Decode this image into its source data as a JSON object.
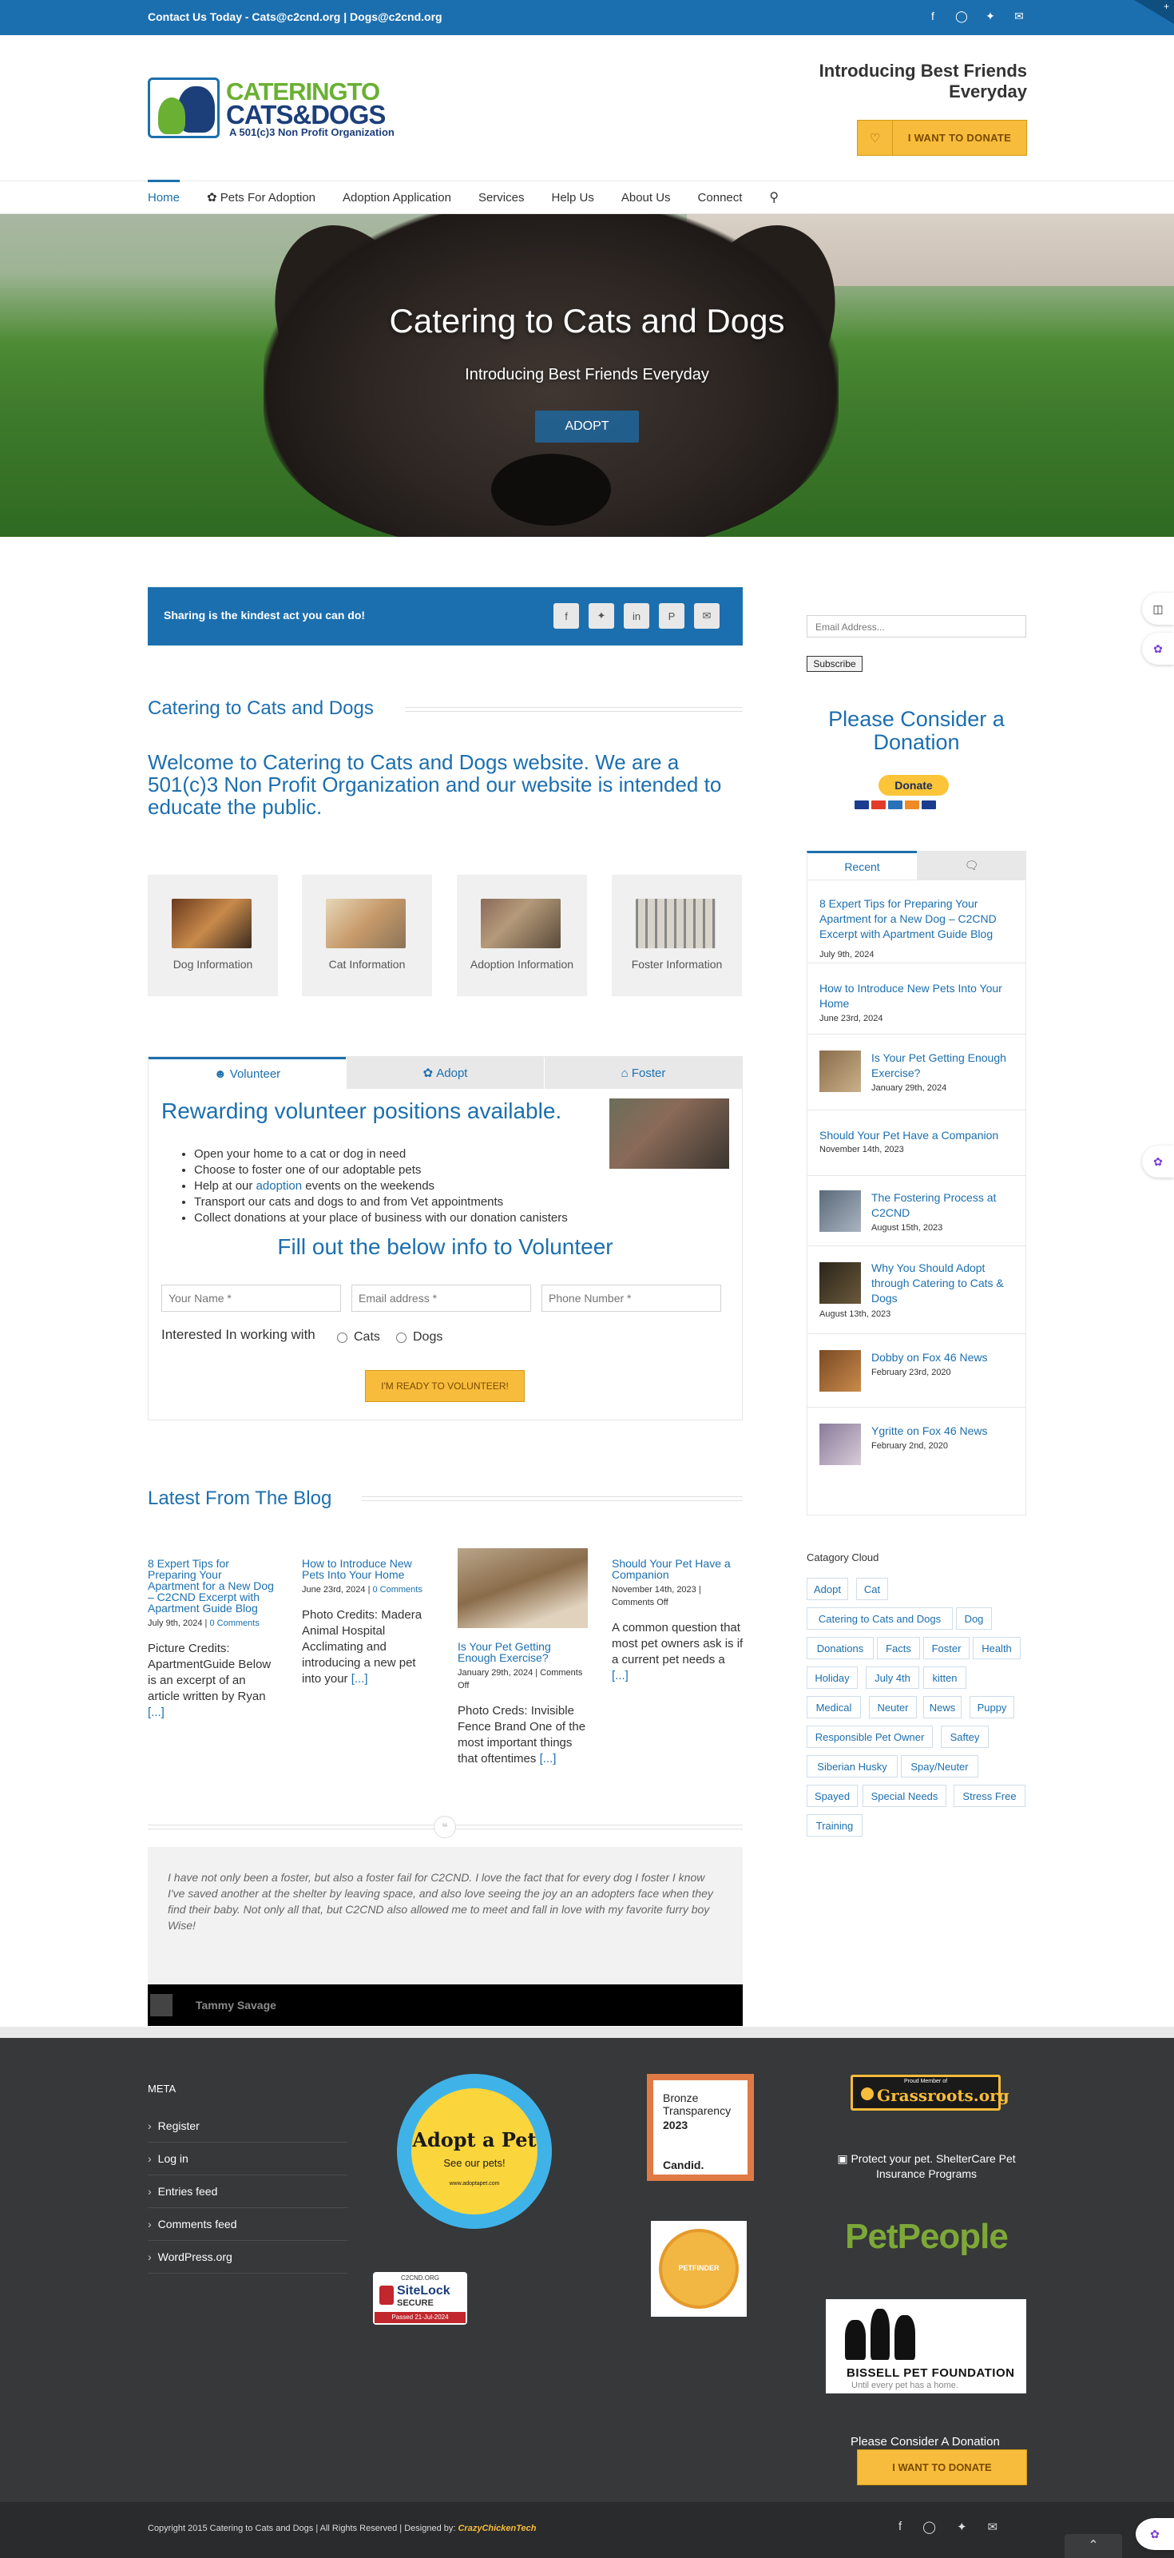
{
  "topbar": {
    "contact_prefix": "Contact Us Today - ",
    "email_cats": "Cats@c2cnd.org",
    "separator": "|",
    "email_dogs": "Dogs@c2cnd.org",
    "social": [
      "facebook-icon",
      "instagram-icon",
      "twitter-icon",
      "envelope-icon"
    ]
  },
  "header": {
    "logo_line1": "CATERINGTO",
    "logo_line2": "CATS&DOGS",
    "logo_line3": "A 501(c)3 Non Profit Organization",
    "tagline": "Introducing Best Friends Everyday",
    "donate_label": "I WANT TO DONATE"
  },
  "nav": {
    "items": [
      "Home",
      "Pets For Adoption",
      "Adoption Application",
      "Services",
      "Help Us",
      "About Us",
      "Connect"
    ]
  },
  "hero": {
    "title": "Catering to Cats and Dogs",
    "subtitle": "Introducing Best Friends Everyday",
    "button": "ADOPT"
  },
  "share": {
    "text": "Sharing is the kindest act you can do!",
    "icons": [
      "facebook-icon",
      "twitter-icon",
      "linkedin-icon",
      "pinterest-icon",
      "envelope-icon"
    ]
  },
  "main": {
    "section_title": "Catering to Cats and Dogs",
    "welcome": "Welcome to Catering to Cats and Dogs website. We are a 501(c)3 Non Profit Organization and our website is intended to educate the public.",
    "cards": [
      {
        "label": "Dog Information"
      },
      {
        "label": "Cat Information"
      },
      {
        "label": "Adoption Information"
      },
      {
        "label": "Foster Information"
      }
    ]
  },
  "tabs": {
    "items": [
      "Volunteer",
      "Adopt",
      "Foster"
    ],
    "heading": "Rewarding volunteer positions available.",
    "list": [
      "Open your home to a cat or dog in need",
      "Choose to foster one of our adoptable pets",
      "Transport our cats and dogs to and from Vet appointments",
      "Collect donations at your place of business with our donation canisters"
    ],
    "list_help_prefix": "Help at our ",
    "list_help_link": "adoption",
    "list_help_suffix": " events on the weekends",
    "form_title": "Fill out the below info to Volunteer",
    "name_placeholder": "Your Name *",
    "email_placeholder": "Email address *",
    "phone_placeholder": "Phone Number *",
    "interest_label": "Interested In working with",
    "option_cats": "Cats",
    "option_dogs": "Dogs",
    "submit": "I'M READY TO VOLUNTEER!"
  },
  "blog": {
    "title": "Latest From The Blog",
    "posts": [
      {
        "title": "8 Expert Tips for Preparing Your Apartment for a New Dog – C2CND Excerpt with Apartment Guide Blog",
        "date": "July 9th, 2024",
        "comments": "0 Comments",
        "body": "Picture Credits: ApartmentGuide Below is an excerpt of an article written by Ryan",
        "more": "[...]"
      },
      {
        "title": "How to Introduce New Pets Into Your Home",
        "date": "June 23rd, 2024",
        "comments": "0 Comments",
        "body": "Photo Credits: Madera Animal Hospital Acclimating and introducing a new pet into your",
        "more": "[...]"
      },
      {
        "title": "Is Your Pet Getting Enough Exercise?",
        "date": "January 29th, 2024",
        "comments": "Comments Off",
        "body": "Photo Creds: Invisible Fence Brand One of the most important things that oftentimes",
        "more": "[...]"
      },
      {
        "title": "Should Your Pet Have a Companion",
        "date": "November 14th, 2023",
        "comments": "Comments Off",
        "body": "A common question that most pet owners ask is if a current pet needs a",
        "more": "[...]"
      }
    ]
  },
  "testimonial": {
    "text": "I have not only been a foster, but also a foster fail for C2CND. I love the fact that for every dog I foster I know I've saved another at the shelter by leaving space, and also love seeing the joy an an adopters face when they find their baby. Not only all that, but C2CND also allowed me to meet and fall in love with my favorite furry boy Wise!",
    "name": "Tammy Savage"
  },
  "sidebar": {
    "email_placeholder": "Email Address...",
    "subscribe": "Subscribe",
    "consider": "Please Consider a Donation",
    "donate": "Donate",
    "tab_recent": "Recent",
    "recent": [
      {
        "title": "8 Expert Tips for Preparing Your Apartment for a New Dog – C2CND Excerpt with Apartment Guide Blog",
        "date": "July 9th, 2024"
      },
      {
        "title": "How to Introduce New Pets Into Your Home",
        "date": "June 23rd, 2024"
      },
      {
        "title": "Is Your Pet Getting Enough Exercise?",
        "date": "January 29th, 2024"
      },
      {
        "title": "Should Your Pet Have a Companion",
        "date": "November 14th, 2023"
      },
      {
        "title": "The Fostering Process at C2CND",
        "date": "August 15th, 2023"
      },
      {
        "title": "Why You Should Adopt through Catering to Cats & Dogs",
        "date": "August 13th, 2023"
      },
      {
        "title": "Dobby on Fox 46 News",
        "date": "February 23rd, 2020"
      },
      {
        "title": "Ygritte on Fox 46 News",
        "date": "February 2nd, 2020"
      }
    ],
    "cloud_title": "Catagory Cloud",
    "tags": [
      "Adopt",
      "Cat",
      "Catering to Cats and Dogs",
      "Dog",
      "Donations",
      "Facts",
      "Foster",
      "Health",
      "Holiday",
      "July 4th",
      "kitten",
      "Medical",
      "Neuter",
      "News",
      "Puppy",
      "Responsible Pet Owner",
      "Saftey",
      "Siberian Husky",
      "Spay/Neuter",
      "Spayed",
      "Special Needs",
      "Stress Free",
      "Training"
    ]
  },
  "footer": {
    "meta_title": "META",
    "meta_links": [
      "Register",
      "Log in",
      "Entries feed",
      "Comments feed",
      "WordPress.org"
    ],
    "aap_title": "Adopt a Pet",
    "aap_sub": "See our pets!",
    "aap_url": "www.adoptapet.com",
    "sitelock_domain": "C2CND.ORG",
    "sitelock_brand": "SiteLock",
    "sitelock_secure": "SECURE",
    "sitelock_passed": "Passed 21-Jul-2024",
    "candid_l1": "Bronze",
    "candid_l2": "Transparency",
    "candid_year": "2023",
    "candid_brand": "Candid.",
    "petfinder_text": "PETFINDER",
    "grassroots_small": "Proud Member of",
    "grassroots": "Grassroots.org",
    "shelter_alt": "Protect your pet. ShelterCare Pet Insurance Programs",
    "petpeople": "PetPeople",
    "bissell_name": "BISSELL PET FOUNDATION",
    "bissell_sub": "Until every pet has a home.",
    "consider": "Please Consider A Donation",
    "donate_label": "I WANT TO DONATE",
    "copyright": "Copyright 2015 Catering to Cats and Dogs | All Rights Reserved | Designed by:",
    "designer": "CrazyChickenTech"
  },
  "colors": {
    "brand_blue": "#1c6fae",
    "accent_yellow": "#f7bc3b",
    "logo_green": "#6ab033",
    "footer_bg": "#363839"
  }
}
